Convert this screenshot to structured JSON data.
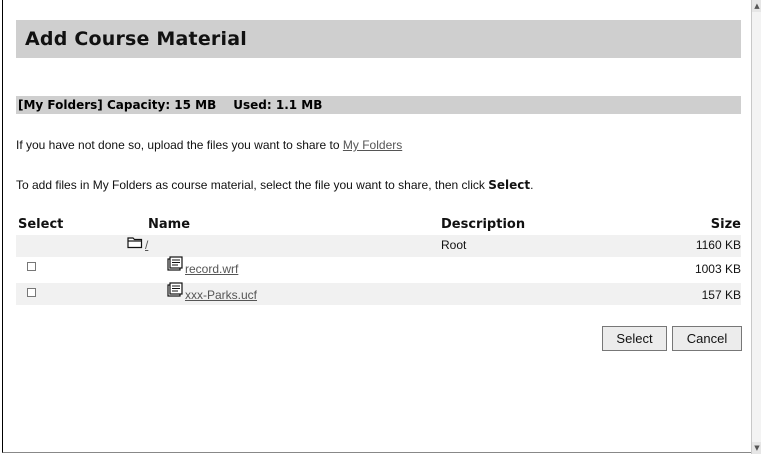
{
  "page": {
    "title": "Add Course Material"
  },
  "capacity": {
    "label": "[My Folders] Capacity: 15 MB",
    "used": "Used: 1.1 MB"
  },
  "instructions": {
    "line1_prefix": "If you have not done so, upload the files you want to share to ",
    "line1_link": "My Folders",
    "line2_prefix": "To add files in My Folders as course material, select the file you want to share, then click ",
    "line2_bold": "Select",
    "line2_suffix": "."
  },
  "table": {
    "columns": [
      "Select",
      "Name",
      "Description",
      "Size"
    ],
    "rows": [
      {
        "name": "/",
        "description": "Root",
        "size": "1160 KB",
        "type": "folder",
        "checkbox": false
      },
      {
        "name": "record.wrf",
        "description": "",
        "size": "1003 KB",
        "type": "file",
        "checkbox": true
      },
      {
        "name": "xxx-Parks.ucf",
        "description": "",
        "size": "157 KB",
        "type": "file",
        "checkbox": true
      }
    ]
  },
  "buttons": {
    "select": "Select",
    "cancel": "Cancel"
  },
  "icons": {
    "folder": "folder-icon",
    "file": "document-icon",
    "scroll_up": "scroll-up-arrow",
    "scroll_down": "scroll-down-arrow"
  }
}
